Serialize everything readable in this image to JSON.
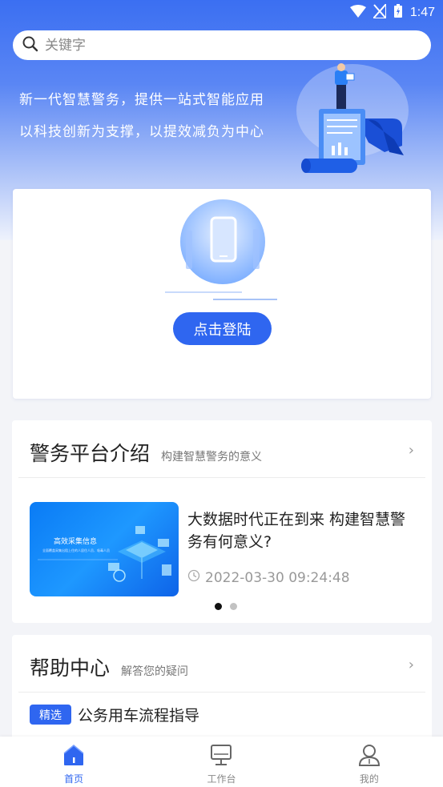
{
  "status_bar": {
    "time": "1:47"
  },
  "search": {
    "placeholder": "关键字"
  },
  "hero": {
    "line1": "新一代智慧警务，提供一站式智能应用",
    "line2": "以科技创新为支撑，以提效减负为中心"
  },
  "login": {
    "button_label": "点击登陆"
  },
  "intro": {
    "title": "警务平台介绍",
    "subtitle": "构建智慧警务的意义",
    "news": {
      "title": "大数据时代正在到来 构建智慧警务有何意义?",
      "time": "2022-03-30 09:24:48",
      "thumb_title": "高效采集信息",
      "thumb_subtitle": "全面覆盖采集出租上住的人居住人员、吸毒人员"
    },
    "carousel": {
      "total": 2,
      "active": 1
    }
  },
  "help": {
    "title": "帮助中心",
    "subtitle": "解答您的疑问",
    "item_tag": "精选",
    "item_text": "公务用车流程指导"
  },
  "tabs": [
    {
      "label": "首页",
      "icon": "home-icon",
      "active": true
    },
    {
      "label": "工作台",
      "icon": "monitor-icon",
      "active": false
    },
    {
      "label": "我的",
      "icon": "user-icon",
      "active": false
    }
  ],
  "colors": {
    "accent": "#2f66f0",
    "hero_top": "#3b6ff2"
  }
}
